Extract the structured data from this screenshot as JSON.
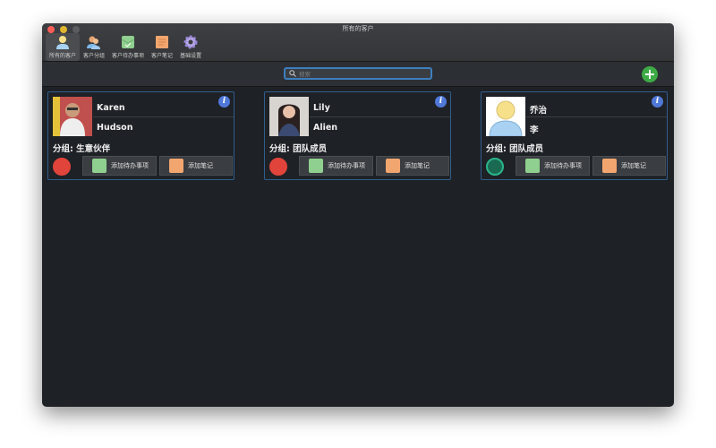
{
  "window": {
    "title": "所有的客户"
  },
  "toolbar": [
    {
      "label": "所有的客户",
      "icon": "person-icon",
      "active": true
    },
    {
      "label": "客户分组",
      "icon": "group-icon"
    },
    {
      "label": "客户待办事项",
      "icon": "todo-icon"
    },
    {
      "label": "客户笔记",
      "icon": "note-icon"
    },
    {
      "label": "基础设置",
      "icon": "gear-icon"
    }
  ],
  "search": {
    "placeholder": "搜索"
  },
  "add_label": "+",
  "info_label": "i",
  "cards": [
    {
      "first": "Karen",
      "last": "Hudson",
      "group": "分组: 生意伙伴",
      "avatar_color": "#e0443a",
      "todo": "添加待办事项",
      "note": "添加笔记"
    },
    {
      "first": "Lily",
      "last": "Alien",
      "group": "分组: 团队成员",
      "avatar_color": "#e0443a",
      "todo": "添加待办事项",
      "note": "添加笔记"
    },
    {
      "first": "乔治",
      "last": "李",
      "group": "分组: 团队成员",
      "avatar_color": "#2bb58a",
      "todo": "添加待办事项",
      "note": "添加笔记"
    }
  ]
}
